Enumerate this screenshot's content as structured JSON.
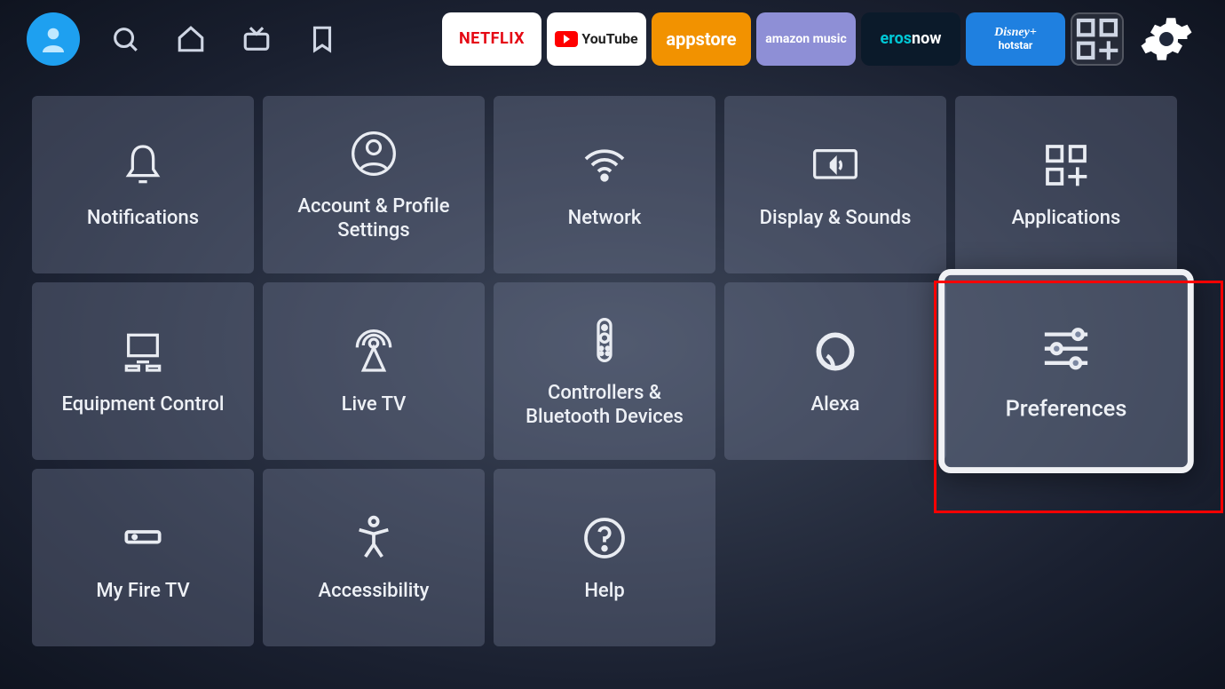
{
  "toolbar": {
    "apps": {
      "netflix": "NETFLIX",
      "youtube": "YouTube",
      "appstore": "appstore",
      "music": "amazon music",
      "eros_prefix": "eros",
      "eros_suffix": "now",
      "hotstar_line1": "Disney+",
      "hotstar_line2": "hotstar"
    }
  },
  "tiles": {
    "notifications": "Notifications",
    "account": "Account & Profile Settings",
    "network": "Network",
    "display": "Display & Sounds",
    "applications": "Applications",
    "equipment": "Equipment Control",
    "livetv": "Live TV",
    "controllers": "Controllers & Bluetooth Devices",
    "alexa": "Alexa",
    "preferences": "Preferences",
    "myfiretv": "My Fire TV",
    "accessibility": "Accessibility",
    "help": "Help"
  }
}
